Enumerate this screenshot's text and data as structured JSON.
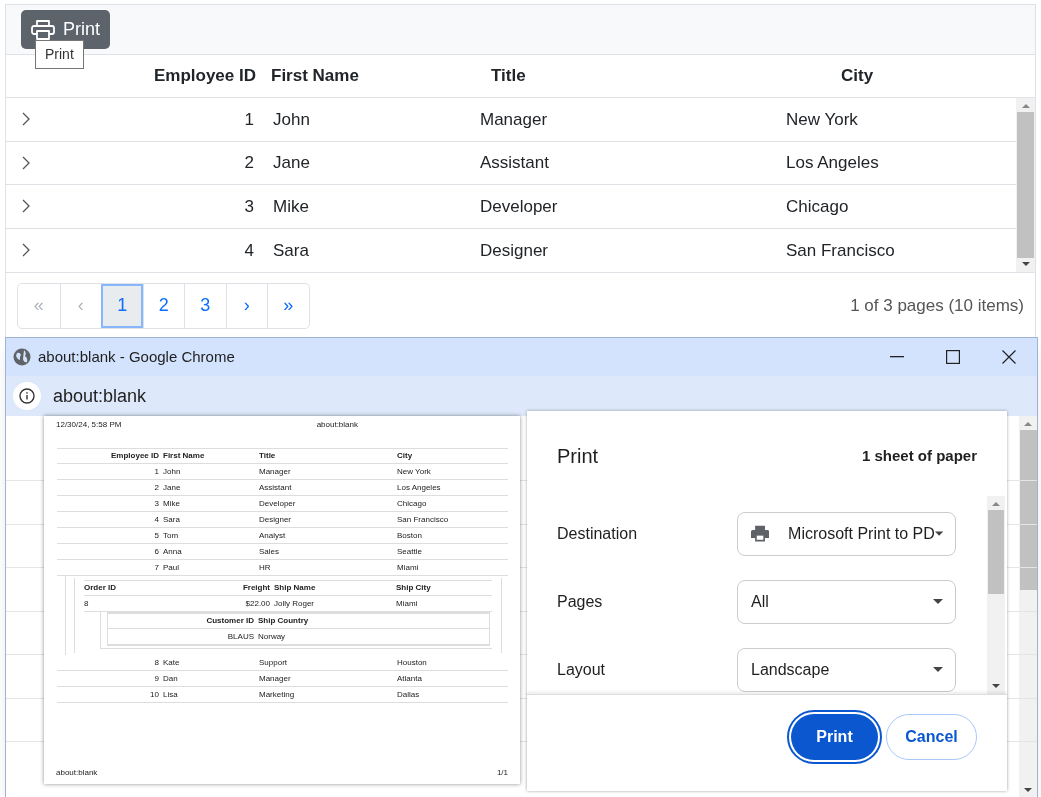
{
  "toolbar": {
    "print_button": "Print",
    "tooltip": "Print"
  },
  "grid": {
    "columns": [
      "Employee ID",
      "First Name",
      "Title",
      "City"
    ],
    "rows": [
      {
        "cells": [
          "1",
          "John",
          "Manager",
          "New York"
        ],
        "expanded": false
      },
      {
        "cells": [
          "2",
          "Jane",
          "Assistant",
          "Los Angeles"
        ],
        "expanded": false
      },
      {
        "cells": [
          "3",
          "Mike",
          "Developer",
          "Chicago"
        ],
        "expanded": false
      },
      {
        "cells": [
          "4",
          "Sara",
          "Designer",
          "San Francisco"
        ],
        "expanded": false
      }
    ]
  },
  "pager": {
    "buttons": [
      {
        "label": "«",
        "selected": false,
        "disabled": true
      },
      {
        "label": "‹",
        "selected": false,
        "disabled": true
      },
      {
        "label": "1",
        "selected": true,
        "disabled": false
      },
      {
        "label": "2",
        "selected": false,
        "disabled": false
      },
      {
        "label": "3",
        "selected": false,
        "disabled": false
      },
      {
        "label": "›",
        "selected": false,
        "disabled": false
      },
      {
        "label": "»",
        "selected": false,
        "disabled": false
      }
    ],
    "info": "1 of 3 pages (10 items)"
  },
  "popup": {
    "title": "about:blank - Google Chrome",
    "address": "about:blank",
    "preview": {
      "date": "12/30/24, 5:58 PM",
      "url": "about:blank",
      "columns": [
        "Employee ID",
        "First Name",
        "Title",
        "City"
      ],
      "rows": [
        {
          "cells": [
            "1",
            "John",
            "Manager",
            "New York"
          ]
        },
        {
          "cells": [
            "2",
            "Jane",
            "Assistant",
            "Los Angeles"
          ]
        },
        {
          "cells": [
            "3",
            "Mike",
            "Developer",
            "Chicago"
          ]
        },
        {
          "cells": [
            "4",
            "Sara",
            "Designer",
            "San Francisco"
          ]
        },
        {
          "cells": [
            "5",
            "Tom",
            "Analyst",
            "Boston"
          ]
        },
        {
          "cells": [
            "6",
            "Anna",
            "Sales",
            "Seattle"
          ]
        },
        {
          "cells": [
            "7",
            "Paul",
            "HR",
            "Miami"
          ],
          "detail": {
            "columns": [
              "Order ID",
              "Freight",
              "Ship Name",
              "Ship City"
            ],
            "rows": [
              {
                "cells": [
                  "8",
                  "$22.00",
                  "Jolly Roger",
                  "Miami"
                ],
                "detail": {
                  "columns": [
                    "Customer ID",
                    "Ship Country"
                  ],
                  "rows": [
                    {
                      "cells": [
                        "BLAUS",
                        "Norway"
                      ]
                    }
                  ]
                }
              }
            ]
          }
        },
        {
          "cells": [
            "8",
            "Kate",
            "Support",
            "Houston"
          ]
        },
        {
          "cells": [
            "9",
            "Dan",
            "Manager",
            "Atlanta"
          ]
        },
        {
          "cells": [
            "10",
            "Lisa",
            "Marketing",
            "Dallas"
          ]
        }
      ],
      "footer_left": "about:blank",
      "footer_right": "1/1"
    },
    "dialog": {
      "title": "Print",
      "sheets": "1 sheet of paper",
      "settings": [
        {
          "label": "Destination",
          "value": "Microsoft Print to PD",
          "kind": "printer"
        },
        {
          "label": "Pages",
          "value": "All",
          "kind": "select"
        },
        {
          "label": "Layout",
          "value": "Landscape",
          "kind": "select"
        }
      ],
      "buttons": [
        {
          "label": "Print",
          "kind": "primary"
        },
        {
          "label": "Cancel",
          "kind": "secondary"
        }
      ]
    }
  }
}
